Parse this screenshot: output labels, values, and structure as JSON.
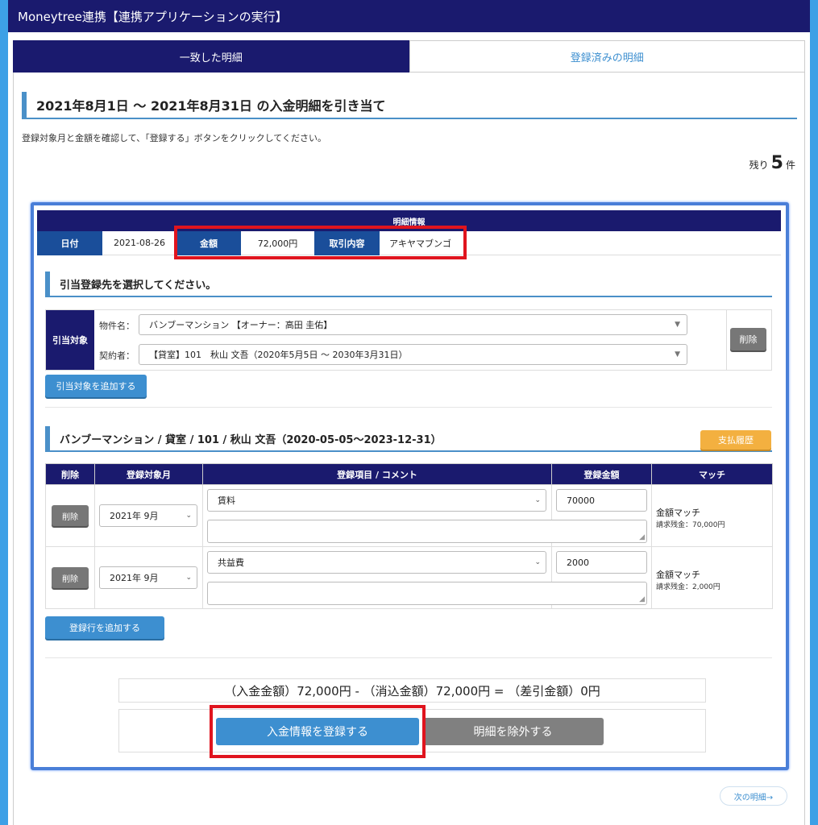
{
  "header": {
    "title": "Moneytree連携【連携アプリケーションの実行】"
  },
  "tabs": [
    {
      "label": "一致した明細",
      "active": true
    },
    {
      "label": "登録済みの明細",
      "active": false
    }
  ],
  "page": {
    "title": "2021年8月1日 〜 2021年8月31日 の入金明細を引き当て",
    "instruction": "登録対象月と金額を確認して、「登録する」ボタンをクリックしてください。",
    "remaining_prefix": "残り",
    "remaining_count": "5",
    "remaining_suffix": "件"
  },
  "detail": {
    "title": "明細情報",
    "date_label": "日付",
    "date_value": "2021-08-26",
    "amount_label": "金額",
    "amount_value": "72,000円",
    "desc_label": "取引内容",
    "desc_value": "アキヤマブンゴ"
  },
  "target": {
    "section_title": "引当登録先を選択してください。",
    "label": "引当対象",
    "property_label": "物件名：",
    "property_value": "バンブーマンション 【オーナー：高田 圭佑】",
    "contractor_label": "契約者：",
    "contractor_value": "【貸室】101　秋山 文吾（2020年5月5日 〜 2030年3月31日）",
    "delete_label": "削除",
    "add_label": "引当対象を追加する"
  },
  "registration": {
    "section_title": "バンブーマンション / 貸室 / 101 / 秋山 文吾（2020-05-05〜2023-12-31）",
    "history_label": "支払履歴",
    "columns": [
      "削除",
      "登録対象月",
      "登録項目 / コメント",
      "登録金額",
      "マッチ"
    ],
    "rows": [
      {
        "delete": "削除",
        "month": "2021年 9月",
        "item": "賃料",
        "amount": "70000",
        "match": "金額マッチ",
        "balance": "請求残金：70,000円"
      },
      {
        "delete": "削除",
        "month": "2021年 9月",
        "item": "共益費",
        "amount": "2000",
        "match": "金額マッチ",
        "balance": "請求残金：2,000円"
      }
    ],
    "add_row_label": "登録行を追加する"
  },
  "summary": {
    "text": "（入金金額）72,000円 - （消込金額）72,000円 = （差引金額）0円"
  },
  "actions": {
    "register_label": "入金情報を登録する",
    "exclude_label": "明細を除外する"
  },
  "footer": {
    "next_label": "次の明細→"
  },
  "colors": {
    "navy": "#1a1a6e",
    "accent_blue": "#3d8fd0",
    "highlight_red": "#e0141e",
    "orange": "#f3b040",
    "gray_button": "#777777"
  }
}
